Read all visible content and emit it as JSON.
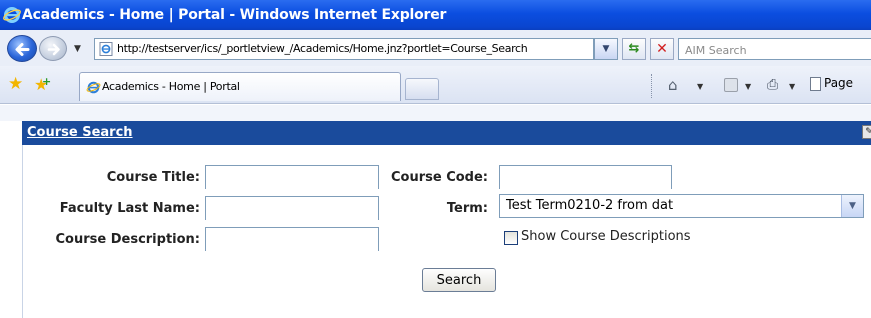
{
  "window": {
    "title": "Academics - Home | Portal - Windows Internet Explorer"
  },
  "addressbar": {
    "url": "http://testserver/ics/_portletview_/Academics/Home.jnz?portlet=Course_Search",
    "search_placeholder": "AIM Search"
  },
  "tabs": [
    {
      "label": "Academics - Home | Portal"
    }
  ],
  "toolbar": {
    "page_label": "Page"
  },
  "portlet": {
    "title": "Course Search"
  },
  "form": {
    "course_title_label": "Course Title:",
    "course_code_label": "Course Code:",
    "faculty_last_name_label": "Faculty Last Name:",
    "term_label": "Term:",
    "course_description_label": "Course Description:",
    "term_selected": "Test Term0210-2 from dat",
    "show_descriptions_label": "Show Course Descriptions",
    "show_descriptions_checked": false,
    "course_title_value": "",
    "course_code_value": "",
    "faculty_last_name_value": "",
    "course_description_value": "",
    "search_button": "Search"
  },
  "colors": {
    "titlebar": "#0b4ee0",
    "portlet_header": "#1a4b9c"
  }
}
